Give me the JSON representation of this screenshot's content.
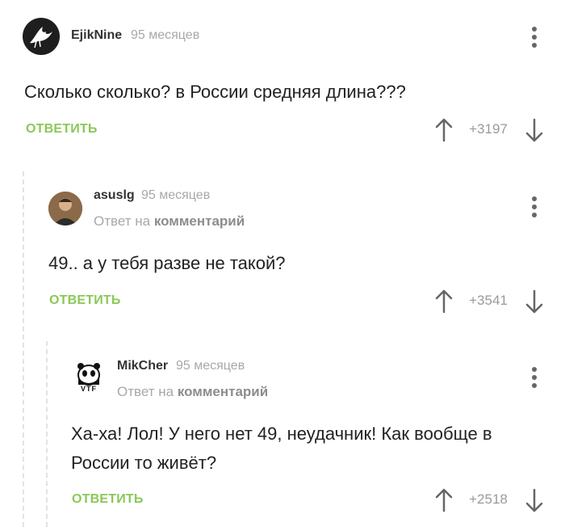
{
  "comments": [
    {
      "username": "EjikNine",
      "time": "95 месяцев",
      "text": "Сколько сколько? в России средняя длина???",
      "reply_label": "ОТВЕТИТЬ",
      "rating": "+3197",
      "avatar_icon": "bird-icon"
    },
    {
      "username": "asuslg",
      "time": "95 месяцев",
      "reply_prefix": "Ответ на",
      "reply_target": "комментарий",
      "text": "49.. а у тебя разве не такой?",
      "reply_label": "ОТВЕТИТЬ",
      "rating": "+3541",
      "avatar_icon": "user-photo-icon"
    },
    {
      "username": "MikCher",
      "time": "95 месяцев",
      "reply_prefix": "Ответ на",
      "reply_target": "комментарий",
      "text_line1": "Ха-ха! Лол! У него нет 49, неудачник! Как вообще в",
      "text_line2": "России то живёт?",
      "reply_label": "ОТВЕТИТЬ",
      "rating": "+2518",
      "avatar_icon": "panda-logo-icon",
      "avatar_text": "VTF"
    }
  ],
  "colors": {
    "accent_green": "#8ac858",
    "muted_gray": "#a8a8a8",
    "text": "#222222"
  }
}
